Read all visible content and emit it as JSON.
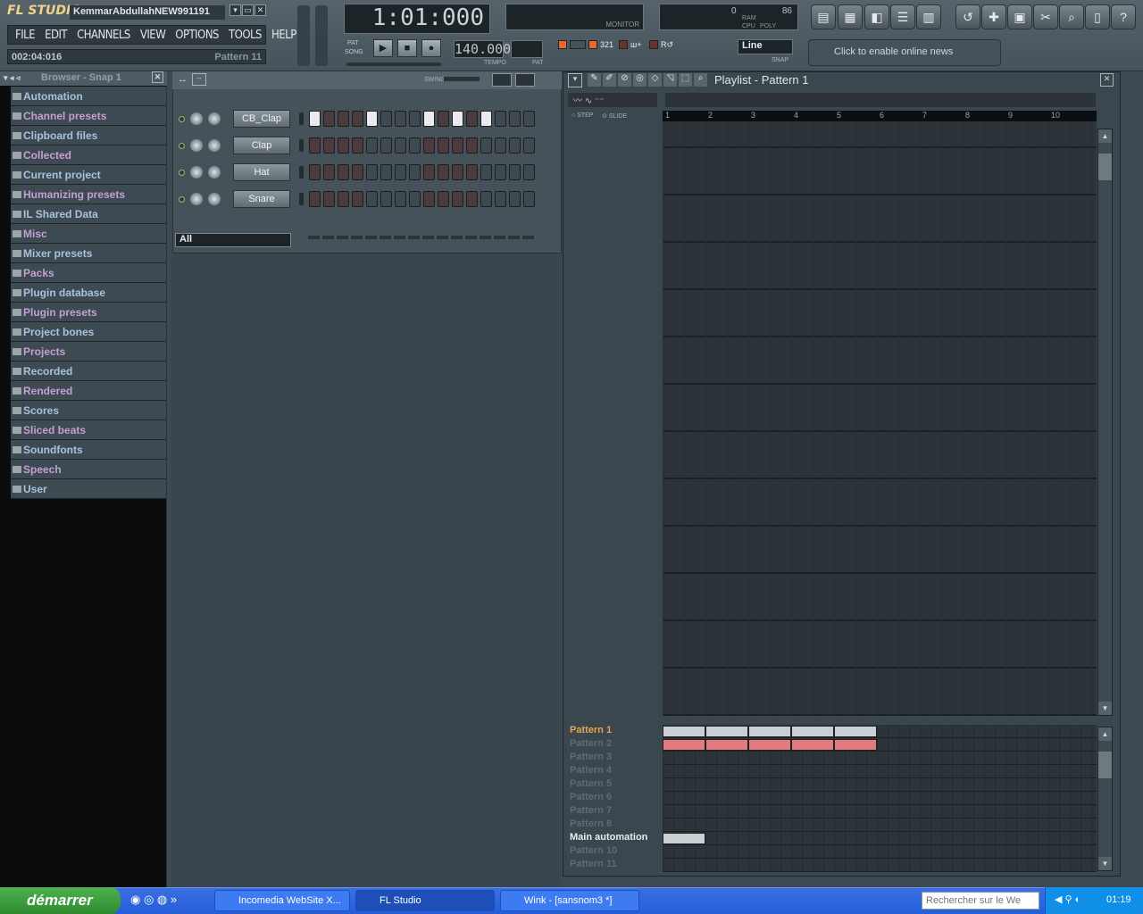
{
  "app": {
    "logo": "FL STUDIO",
    "project_title": "KemmarAbdullahNEW991191",
    "window_buttons": [
      "▾",
      "▭",
      "✕"
    ]
  },
  "menu": [
    "FILE",
    "EDIT",
    "CHANNELS",
    "VIEW",
    "OPTIONS",
    "TOOLS",
    "HELP"
  ],
  "hint_bar": {
    "time": "002:04:016",
    "pattern": "Pattern 11"
  },
  "transport": {
    "time": "1:01:000",
    "tempo": "140.000",
    "tempo_label": "TEMPO",
    "pat_label": "PAT",
    "mode_pat": "PAT",
    "mode_song": "SONG",
    "monitor_label": "MONITOR",
    "cpu_label": "CPU",
    "poly_label": "POLY",
    "ram_label": "RAM",
    "cpu_value": "0",
    "ram_value": "86"
  },
  "toolbar": {
    "snap_value": "Line",
    "snap_label": "SNAP",
    "news": "Click to enable online news"
  },
  "browser": {
    "title": "Browser - Snap 1",
    "items": [
      "Automation",
      "Channel presets",
      "Clipboard files",
      "Collected",
      "Current project",
      "Humanizing presets",
      "IL Shared Data",
      "Misc",
      "Mixer presets",
      "Packs",
      "Plugin database",
      "Plugin presets",
      "Project bones",
      "Projects",
      "Recorded",
      "Rendered",
      "Scores",
      "Sliced beats",
      "Soundfonts",
      "Speech",
      "User"
    ]
  },
  "stepseq": {
    "swing_label": "SWING",
    "filter": "All",
    "channels": [
      {
        "name": "CB_Clap",
        "steps": [
          1,
          0,
          0,
          0,
          1,
          0,
          0,
          0,
          1,
          0,
          1,
          0,
          1,
          0,
          0,
          0
        ]
      },
      {
        "name": "Clap",
        "steps": [
          0,
          0,
          0,
          0,
          0,
          0,
          0,
          0,
          0,
          0,
          0,
          0,
          0,
          0,
          0,
          0
        ]
      },
      {
        "name": "Hat",
        "steps": [
          0,
          0,
          0,
          0,
          0,
          0,
          0,
          0,
          0,
          0,
          0,
          0,
          0,
          0,
          0,
          0
        ]
      },
      {
        "name": "Snare",
        "steps": [
          0,
          0,
          0,
          0,
          0,
          0,
          0,
          0,
          0,
          0,
          0,
          0,
          0,
          0,
          0,
          0
        ]
      }
    ]
  },
  "playlist": {
    "title": "Playlist - Pattern 1",
    "step_label": "STEP",
    "slide_label": "SLIDE",
    "ruler": [
      "1",
      "2",
      "3",
      "4",
      "5",
      "6",
      "7",
      "8",
      "9",
      "10"
    ],
    "patterns": [
      "Pattern 1",
      "Pattern 2",
      "Pattern 3",
      "Pattern 4",
      "Pattern 5",
      "Pattern 6",
      "Pattern 7",
      "Pattern 8",
      "Main automation",
      "Pattern 10",
      "Pattern 11"
    ]
  },
  "taskbar": {
    "start": "démarrer",
    "tasks": [
      "Incomedia WebSite X...",
      "FL Studio",
      "Wink - [sansnom3 *]"
    ],
    "search_placeholder": "Rechercher sur le We",
    "clock": "01:19"
  }
}
